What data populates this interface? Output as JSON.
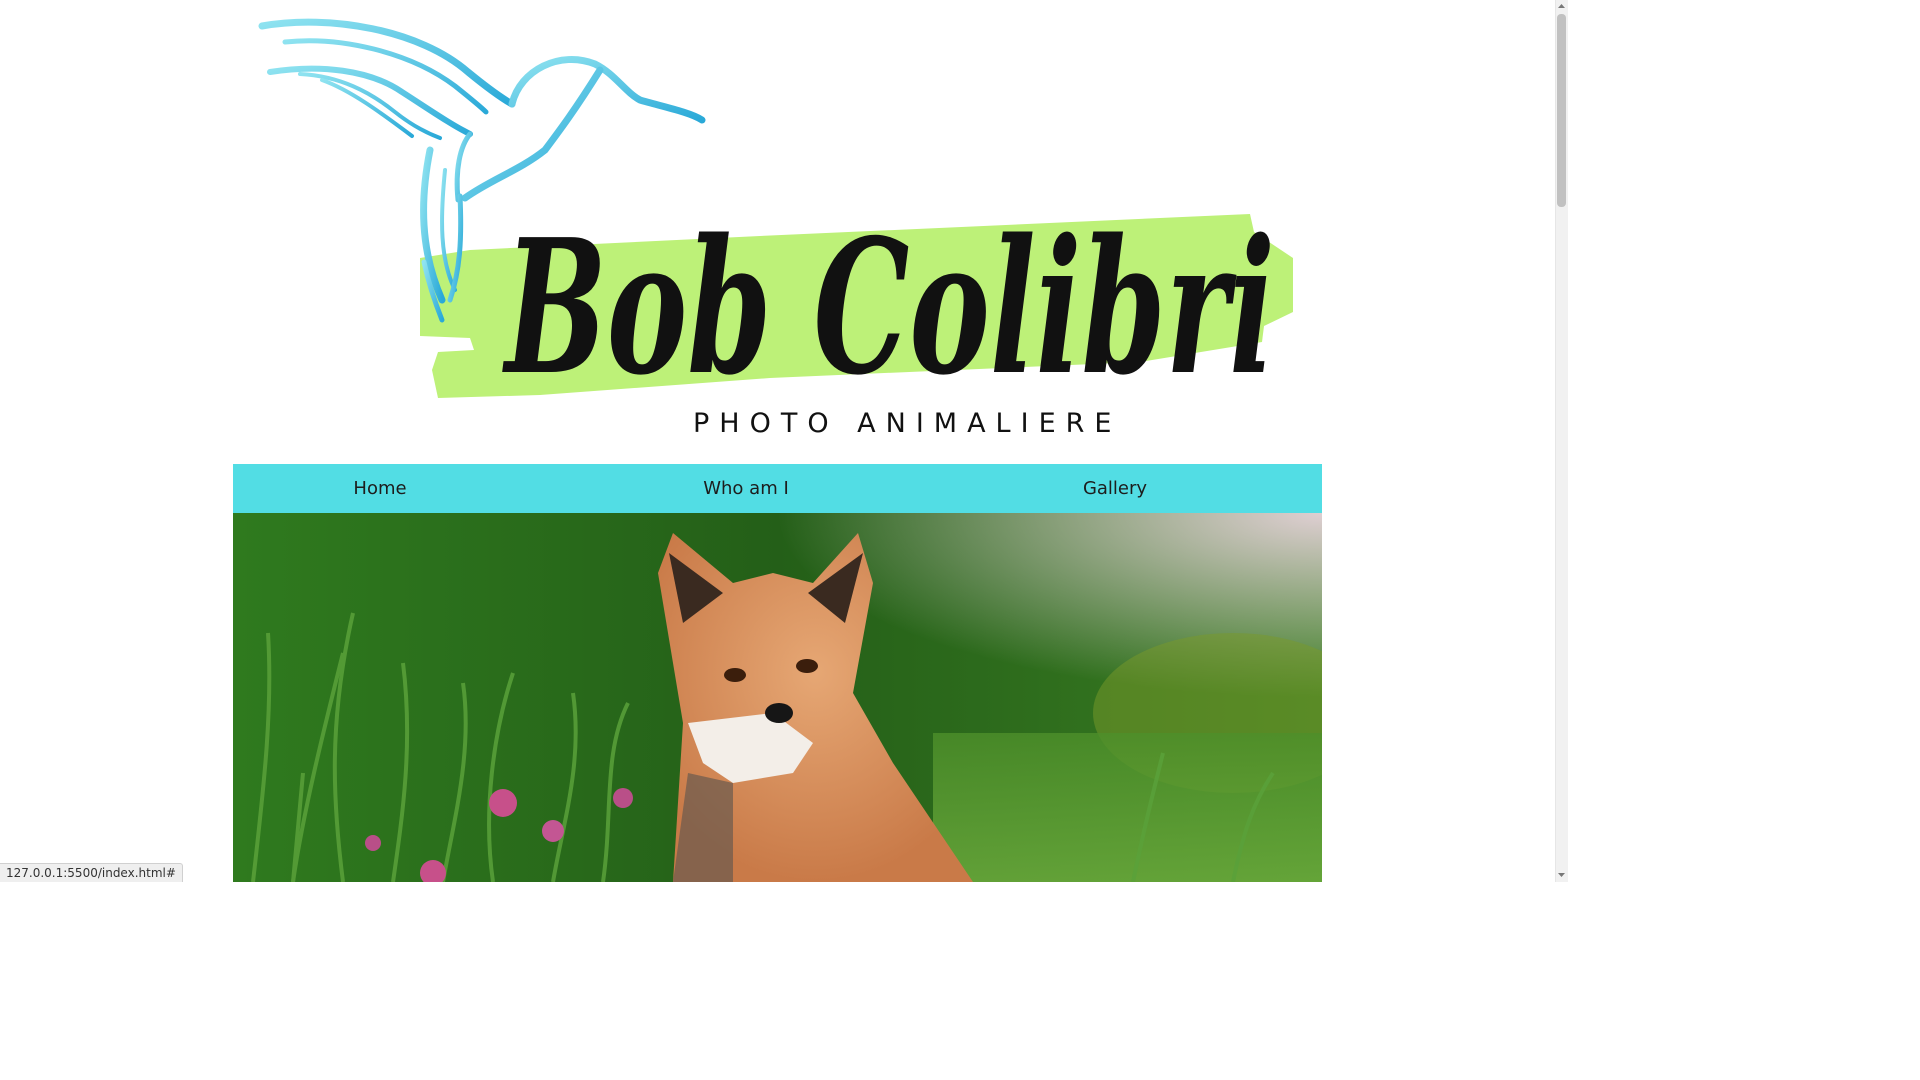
{
  "site": {
    "brand_name": "Bob Colibri",
    "tagline": "PHOTO ANIMALIERE"
  },
  "nav": {
    "items": [
      {
        "label": "Home"
      },
      {
        "label": "Who am I"
      },
      {
        "label": "Gallery"
      }
    ]
  },
  "colors": {
    "nav_bg": "#52dde4",
    "brush_green": "#bdf178",
    "bird_blue": "#3cbfe0"
  },
  "hero": {
    "subject": "red fox in grass"
  },
  "status_bar": {
    "url": "127.0.0.1:5500/index.html#"
  }
}
